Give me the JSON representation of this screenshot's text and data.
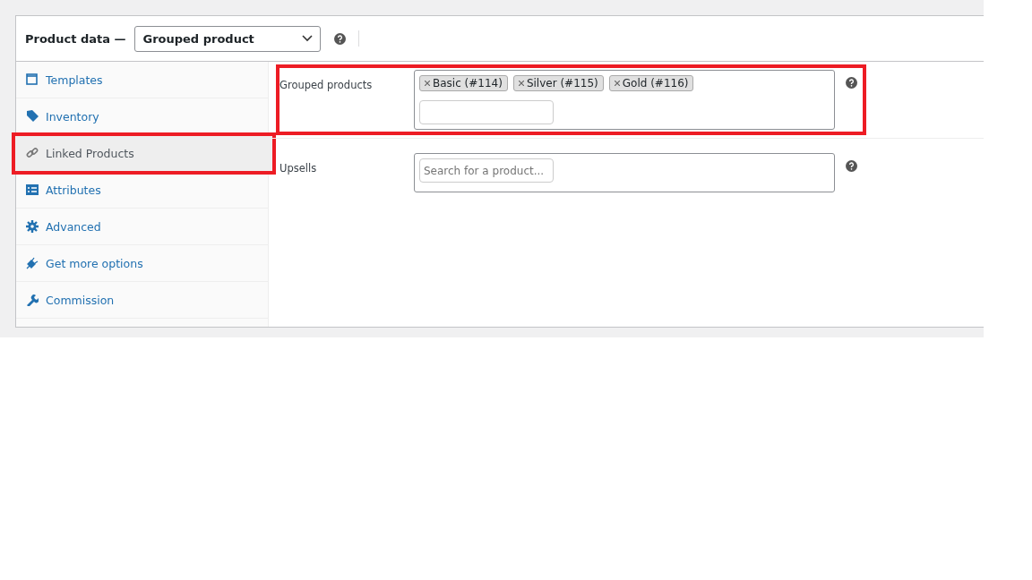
{
  "header": {
    "title": "Product data —",
    "product_type": "Grouped product"
  },
  "tabs": [
    {
      "label": "Templates",
      "selected": false,
      "highlighted": false
    },
    {
      "label": "Inventory",
      "selected": false,
      "highlighted": false
    },
    {
      "label": "Linked Products",
      "selected": true,
      "highlighted": true
    },
    {
      "label": "Attributes",
      "selected": false,
      "highlighted": false
    },
    {
      "label": "Advanced",
      "selected": false,
      "highlighted": false
    },
    {
      "label": "Get more options",
      "selected": false,
      "highlighted": false
    },
    {
      "label": "Commission",
      "selected": false,
      "highlighted": false
    }
  ],
  "fields": [
    {
      "label": "Grouped products",
      "highlighted": true,
      "tags": [
        "Basic (#114)",
        "Silver (#115)",
        "Gold (#116)"
      ]
    },
    {
      "label": "Upsells",
      "highlighted": false,
      "placeholder": "Search for a product..."
    }
  ]
}
